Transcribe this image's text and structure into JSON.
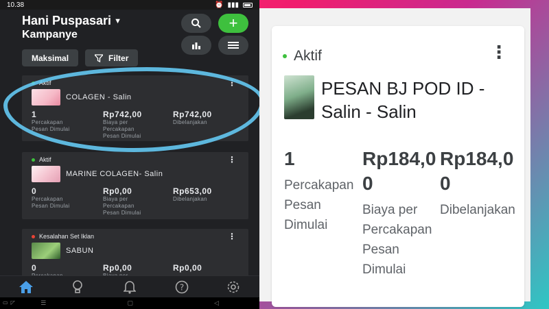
{
  "status_bar": {
    "time": "10.38"
  },
  "header": {
    "account_name": "Hani Puspasari",
    "subtitle": "Kampanye"
  },
  "chips": {
    "sort_label": "Maksimal",
    "filter_label": "Filter"
  },
  "colors": {
    "active": "#3ec03e",
    "error": "#ea4335",
    "highlight": "#64c8f2"
  },
  "campaigns": [
    {
      "status": "Aktif",
      "name": "COLAGEN - Salin",
      "metrics": [
        {
          "value": "1",
          "label_lines": [
            "Percakapan",
            "Pesan Dimulai"
          ]
        },
        {
          "value": "Rp742,00",
          "label_lines": [
            "Biaya per",
            "Percakapan",
            "Pesan Dimulai"
          ]
        },
        {
          "value": "Rp742,00",
          "label_lines": [
            "Dibelanjakan"
          ]
        }
      ]
    },
    {
      "status": "Aktif",
      "name": "MARINE COLAGEN- Salin",
      "metrics": [
        {
          "value": "0",
          "label_lines": [
            "Percakapan",
            "Pesan Dimulai"
          ]
        },
        {
          "value": "Rp0,00",
          "label_lines": [
            "Biaya per",
            "Percakapan",
            "Pesan Dimulai"
          ]
        },
        {
          "value": "Rp653,00",
          "label_lines": [
            "Dibelanjakan"
          ]
        }
      ]
    },
    {
      "status": "Kesalahan Set Iklan",
      "name": "SABUN",
      "metrics": [
        {
          "value": "0",
          "label_lines": [
            "Percakapan"
          ]
        },
        {
          "value": "Rp0,00",
          "label_lines": [
            "Biaya per"
          ]
        },
        {
          "value": "Rp0,00",
          "label_lines": [
            ""
          ]
        }
      ]
    }
  ],
  "zoom_card": {
    "status": "Aktif",
    "name": "PESAN BJ POD ID - Salin - Salin",
    "metrics": [
      {
        "value": "1",
        "label": "Percakapan Pesan Dimulai"
      },
      {
        "value": "Rp184,00",
        "label": "Biaya per Percakapan Pesan Dimulai"
      },
      {
        "value": "Rp184,00",
        "label": "Dibelanjakan"
      }
    ]
  }
}
